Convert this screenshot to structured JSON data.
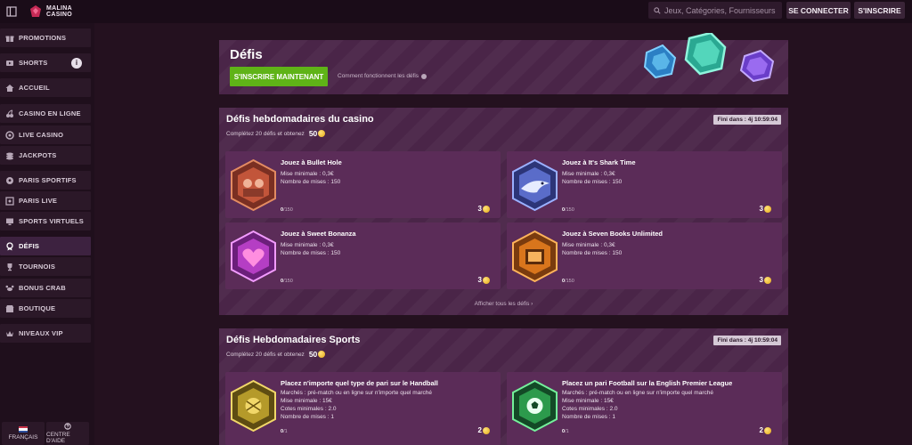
{
  "header": {
    "logo_text_1": "MALINA",
    "logo_text_2": "CASINO",
    "search_placeholder": "Jeux, Catégories, Fournisseurs",
    "login_label": "SE CONNECTER",
    "register_label": "S'INSCRIRE"
  },
  "sidebar": {
    "items": [
      {
        "label": "PROMOTIONS",
        "icon": "gift-icon"
      },
      {
        "label": "SHORTS",
        "icon": "video-icon",
        "badge": "i"
      },
      {
        "label": "ACCUEIL",
        "icon": "home-icon"
      },
      {
        "label": "CASINO EN LIGNE",
        "icon": "cherry-icon"
      },
      {
        "label": "LIVE CASINO",
        "icon": "chip-icon"
      },
      {
        "label": "JACKPOTS",
        "icon": "coins-icon"
      },
      {
        "label": "PARIS SPORTIFS",
        "icon": "ball-icon"
      },
      {
        "label": "PARIS LIVE",
        "icon": "live-icon"
      },
      {
        "label": "SPORTS VIRTUELS",
        "icon": "monitor-icon"
      },
      {
        "label": "DÉFIS",
        "icon": "medal-icon",
        "active": true
      },
      {
        "label": "TOURNOIS",
        "icon": "trophy-icon"
      },
      {
        "label": "BONUS CRAB",
        "icon": "crab-icon"
      },
      {
        "label": "BOUTIQUE",
        "icon": "shop-icon"
      },
      {
        "label": "NIVEAUX VIP",
        "icon": "vip-icon"
      }
    ],
    "language_label": "FRANÇAIS",
    "help_label": "CENTRE D'AIDE"
  },
  "hero": {
    "title": "Défis",
    "cta_label": "S'INSCRIRE MAINTENANT",
    "how_label": "Comment fonctionnent les défis"
  },
  "casino_section": {
    "title": "Défis hebdomadaires du casino",
    "subtitle": "Complétez 20 défis et obtenez",
    "reward": "50",
    "timer": "Fini dans : 4j 10:59:04",
    "show_all": "Afficher tous les défis  ›",
    "cards": [
      {
        "title": "Jouez à Bullet Hole",
        "line1": "Mise minimale : 0,3€",
        "line2": "Nombre de mises : 150",
        "progress_done": "0",
        "progress_total": "/150",
        "reward": "3",
        "color": "#c2553a"
      },
      {
        "title": "Jouez à It's Shark Time",
        "line1": "Mise minimale : 0,3€",
        "line2": "Nombre de mises : 150",
        "progress_done": "0",
        "progress_total": "/150",
        "reward": "3",
        "color": "#5a6cc9"
      },
      {
        "title": "Jouez à Sweet Bonanza",
        "line1": "Mise minimale : 0,3€",
        "line2": "Nombre de mises : 150",
        "progress_done": "0",
        "progress_total": "/150",
        "reward": "3",
        "color": "#b53ec4"
      },
      {
        "title": "Jouez à Seven Books Unlimited",
        "line1": "Mise minimale : 0,3€",
        "line2": "Nombre de mises : 150",
        "progress_done": "0",
        "progress_total": "/150",
        "reward": "3",
        "color": "#d9751c"
      }
    ]
  },
  "sports_section": {
    "title": "Défis Hebdomadaires Sports",
    "subtitle": "Complétez 20 défis et obtenez",
    "reward": "50",
    "timer": "Fini dans : 4j 10:59:04",
    "cards": [
      {
        "title": "Placez n'importe quel type de pari sur le Handball",
        "line1": "Marchés : pré-match ou en ligne sur n'importe quel marché",
        "line2": "Mise minimale : 15€",
        "line3": "Cotes minimales : 2.0",
        "line4": "Nombre de mises : 1",
        "progress_done": "0",
        "progress_total": "/1",
        "reward": "2",
        "color": "#b59a2a"
      },
      {
        "title": "Placez un pari Football sur la English Premier League",
        "line1": "Marchés : pré-match ou en ligne sur n'importe quel marché",
        "line2": "Mise minimale : 15€",
        "line3": "Cotes minimales : 2.0",
        "line4": "Nombre de mises : 1",
        "progress_done": "0",
        "progress_total": "/1",
        "reward": "2",
        "color": "#2c9a4c"
      }
    ]
  }
}
